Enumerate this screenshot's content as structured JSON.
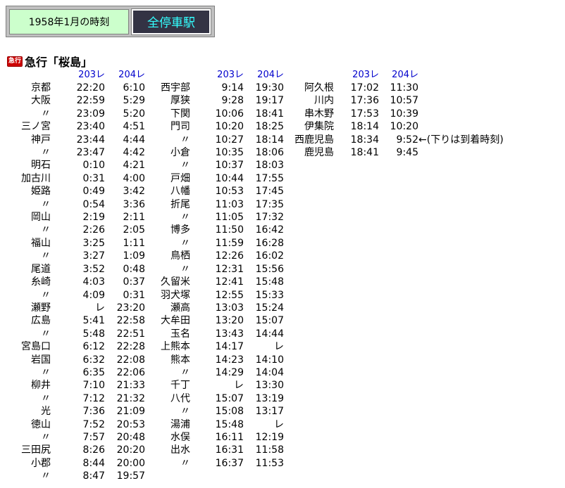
{
  "header": {
    "date_label": "1958年1月の時刻",
    "link_label": "全停車駅"
  },
  "badge": "急行",
  "title": "急行「桜島」",
  "train_down": "203レ",
  "train_up": "204レ",
  "note": "←(下りは到着時刻)",
  "col1": [
    [
      "京都",
      "22:20",
      "6:10"
    ],
    [
      "大阪",
      "22:59",
      "5:29"
    ],
    [
      "〃",
      "23:09",
      "5:20"
    ],
    [
      "三ノ宮",
      "23:40",
      "4:51"
    ],
    [
      "神戸",
      "23:44",
      "4:44"
    ],
    [
      "〃",
      "23:47",
      "4:42"
    ],
    [
      "明石",
      "0:10",
      "4:21"
    ],
    [
      "加古川",
      "0:31",
      "4:00"
    ],
    [
      "姫路",
      "0:49",
      "3:42"
    ],
    [
      "〃",
      "0:54",
      "3:36"
    ],
    [
      "岡山",
      "2:19",
      "2:11"
    ],
    [
      "〃",
      "2:26",
      "2:05"
    ],
    [
      "福山",
      "3:25",
      "1:11"
    ],
    [
      "〃",
      "3:27",
      "1:09"
    ],
    [
      "尾道",
      "3:52",
      "0:48"
    ],
    [
      "糸崎",
      "4:03",
      "0:37"
    ],
    [
      "〃",
      "4:09",
      "0:31"
    ],
    [
      "瀬野",
      "レ",
      "23:20"
    ],
    [
      "広島",
      "5:41",
      "22:58"
    ],
    [
      "〃",
      "5:48",
      "22:51"
    ],
    [
      "宮島口",
      "6:12",
      "22:28"
    ],
    [
      "岩国",
      "6:32",
      "22:08"
    ],
    [
      "〃",
      "6:35",
      "22:06"
    ],
    [
      "柳井",
      "7:10",
      "21:33"
    ],
    [
      "〃",
      "7:12",
      "21:32"
    ],
    [
      "光",
      "7:36",
      "21:09"
    ],
    [
      "徳山",
      "7:52",
      "20:53"
    ],
    [
      "〃",
      "7:57",
      "20:48"
    ],
    [
      "三田尻",
      "8:26",
      "20:20"
    ],
    [
      "小郡",
      "8:44",
      "20:00"
    ],
    [
      "〃",
      "8:47",
      "19:57"
    ]
  ],
  "col2": [
    [
      "西宇部",
      "9:14",
      "19:30"
    ],
    [
      "厚狭",
      "9:28",
      "19:17"
    ],
    [
      "下関",
      "10:06",
      "18:41"
    ],
    [
      "門司",
      "10:20",
      "18:25"
    ],
    [
      "〃",
      "10:27",
      "18:14"
    ],
    [
      "小倉",
      "10:35",
      "18:06"
    ],
    [
      "〃",
      "10:37",
      "18:03"
    ],
    [
      "戸畑",
      "10:44",
      "17:55"
    ],
    [
      "八幡",
      "10:53",
      "17:45"
    ],
    [
      "折尾",
      "11:03",
      "17:35"
    ],
    [
      "〃",
      "11:05",
      "17:32"
    ],
    [
      "博多",
      "11:50",
      "16:42"
    ],
    [
      "〃",
      "11:59",
      "16:28"
    ],
    [
      "鳥栖",
      "12:26",
      "16:02"
    ],
    [
      "〃",
      "12:31",
      "15:56"
    ],
    [
      "久留米",
      "12:41",
      "15:48"
    ],
    [
      "羽犬塚",
      "12:55",
      "15:33"
    ],
    [
      "瀬高",
      "13:03",
      "15:24"
    ],
    [
      "大牟田",
      "13:20",
      "15:07"
    ],
    [
      "玉名",
      "13:43",
      "14:44"
    ],
    [
      "上熊本",
      "14:17",
      "レ"
    ],
    [
      "熊本",
      "14:23",
      "14:10"
    ],
    [
      "〃",
      "14:29",
      "14:04"
    ],
    [
      "千丁",
      "レ",
      "13:30"
    ],
    [
      "八代",
      "15:07",
      "13:19"
    ],
    [
      "〃",
      "15:08",
      "13:17"
    ],
    [
      "湯浦",
      "15:48",
      "レ"
    ],
    [
      "水俣",
      "16:11",
      "12:19"
    ],
    [
      "出水",
      "16:31",
      "11:58"
    ],
    [
      "〃",
      "16:37",
      "11:53"
    ]
  ],
  "col3": [
    [
      "阿久根",
      "17:02",
      "11:30"
    ],
    [
      "川内",
      "17:36",
      "10:57"
    ],
    [
      "串木野",
      "17:53",
      "10:39"
    ],
    [
      "伊集院",
      "18:14",
      "10:20"
    ],
    [
      "西鹿児島",
      "18:34",
      "9:52"
    ],
    [
      "鹿児島",
      "18:41",
      "9:45"
    ]
  ]
}
